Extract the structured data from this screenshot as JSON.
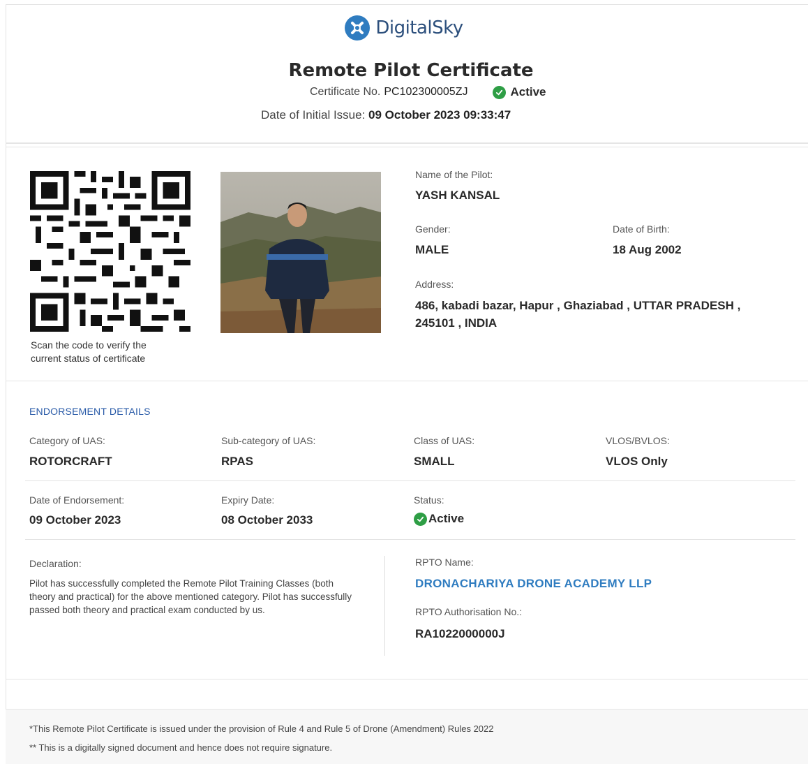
{
  "brand": {
    "name": "DigitalSky"
  },
  "certificate": {
    "title": "Remote Pilot Certificate",
    "number_label": "Certificate No.",
    "number": "PC102300005ZJ",
    "status": "Active",
    "issue_label": "Date of Initial Issue:",
    "issue_date": "09 October 2023 09:33:47"
  },
  "qr": {
    "caption_line1": "Scan the code to verify the",
    "caption_line2": "current status of certificate"
  },
  "pilot": {
    "name_label": "Name of the Pilot:",
    "name": "YASH KANSAL",
    "gender_label": "Gender:",
    "gender": "MALE",
    "dob_label": "Date of Birth:",
    "dob": "18 Aug 2002",
    "address_label": "Address:",
    "address_line1": "486, kabadi bazar, Hapur , Ghaziabad , UTTAR PRADESH ,",
    "address_line2": "245101 , INDIA"
  },
  "endorsement": {
    "section_title": "ENDORSEMENT DETAILS",
    "category_label": "Category of UAS:",
    "category": "ROTORCRAFT",
    "subcategory_label": "Sub-category of UAS:",
    "subcategory": "RPAS",
    "class_label": "Class of UAS:",
    "class": "SMALL",
    "vlos_label": "VLOS/BVLOS:",
    "vlos": "VLOS Only",
    "endorse_date_label": "Date of Endorsement:",
    "endorse_date": "09 October 2023",
    "expiry_label": "Expiry Date:",
    "expiry": "08 October 2033",
    "status_label": "Status:",
    "status": "Active"
  },
  "declaration": {
    "label": "Declaration:",
    "text": "Pilot has successfully completed the Remote Pilot Training Classes (both theory and practical) for the above mentioned category. Pilot has successfully passed both theory and practical exam conducted by us."
  },
  "rpto": {
    "name_label": "RPTO Name:",
    "name": "DRONACHARIYA DRONE ACADEMY LLP",
    "auth_label": "RPTO Authorisation No.:",
    "auth_no": "RA1022000000J"
  },
  "footer": {
    "note1": "*This Remote Pilot Certificate is issued under the provision of Rule 4 and Rule 5 of Drone (Amendment) Rules 2022",
    "note2": "** This is a digitally signed document and hence does not require signature."
  },
  "colors": {
    "brand_blue": "#2f7cc0",
    "status_green": "#2e9e45",
    "section_blue": "#2a5ba8"
  }
}
